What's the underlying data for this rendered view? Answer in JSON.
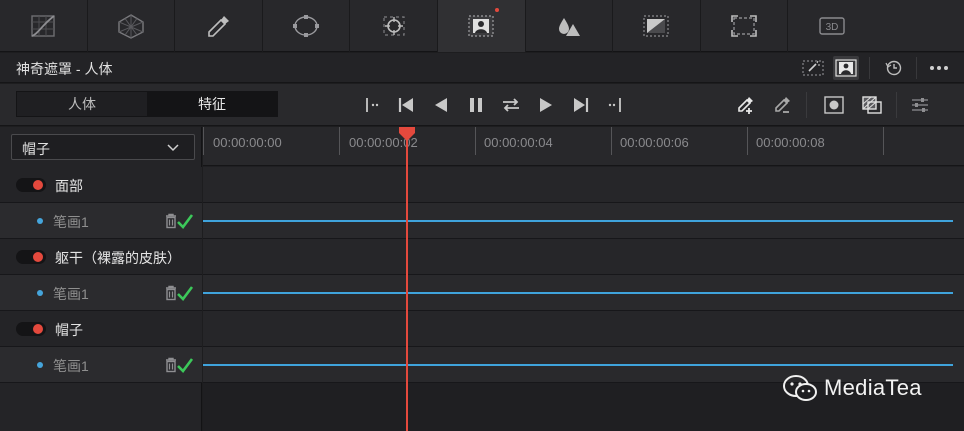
{
  "window": {
    "title": "神奇遮罩 - 人体"
  },
  "toolbar": {
    "tools": [
      "curves-icon",
      "color-warper-icon",
      "qualifier-icon",
      "window-icon",
      "tracker-icon",
      "magic-mask-icon",
      "blur-icon",
      "key-icon",
      "sizing-icon",
      "3d-icon"
    ],
    "badge_3d": "3D"
  },
  "mode_tabs": [
    "人体",
    "特征"
  ],
  "active_mode": "特征",
  "feature_select": {
    "value": "帽子"
  },
  "timeline": {
    "timecodes": [
      "00:00:00:00",
      "00:00:00:02",
      "00:00:00:04",
      "00:00:00:06",
      "00:00:00:08"
    ]
  },
  "features": [
    {
      "name": "面部",
      "strokes": [
        {
          "name": "笔画1"
        }
      ]
    },
    {
      "name": "躯干（裸露的皮肤）",
      "strokes": [
        {
          "name": "笔画1"
        }
      ]
    },
    {
      "name": "帽子",
      "strokes": [
        {
          "name": "笔画1"
        }
      ]
    }
  ],
  "watermark": "MediaTea",
  "colors": {
    "accent_red": "#e4493d",
    "stroke_blue": "#3fa3dc",
    "check_green": "#3cc85a"
  }
}
